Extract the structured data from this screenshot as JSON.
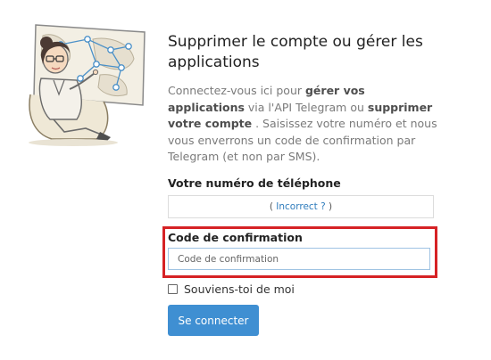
{
  "page": {
    "title": "Supprimer le compte ou gérer les applications",
    "intro": {
      "part1": "Connectez-vous ici pour ",
      "bold1": "gérer vos applications",
      "part2": " via l'API Telegram ou ",
      "bold2": "supprimer votre compte",
      "part3": " . Saisissez votre numéro et nous vous enverrons un code de confirmation par Telegram (et non par SMS)."
    }
  },
  "phone": {
    "label": "Votre numéro de téléphone",
    "incorrect_link": "Incorrect ?",
    "close_paren": " )",
    "open_paren": "( "
  },
  "code": {
    "label": "Code de confirmation",
    "placeholder": "Code de confirmation",
    "value": ""
  },
  "remember": {
    "label": "Souviens-toi de moi",
    "checked": false
  },
  "submit": {
    "label": "Se connecter"
  },
  "colors": {
    "accent": "#3f8fd2",
    "highlight": "#d62225",
    "link": "#2f7cbc"
  },
  "icons": {
    "illustration": "telegram-lady-illustration"
  }
}
